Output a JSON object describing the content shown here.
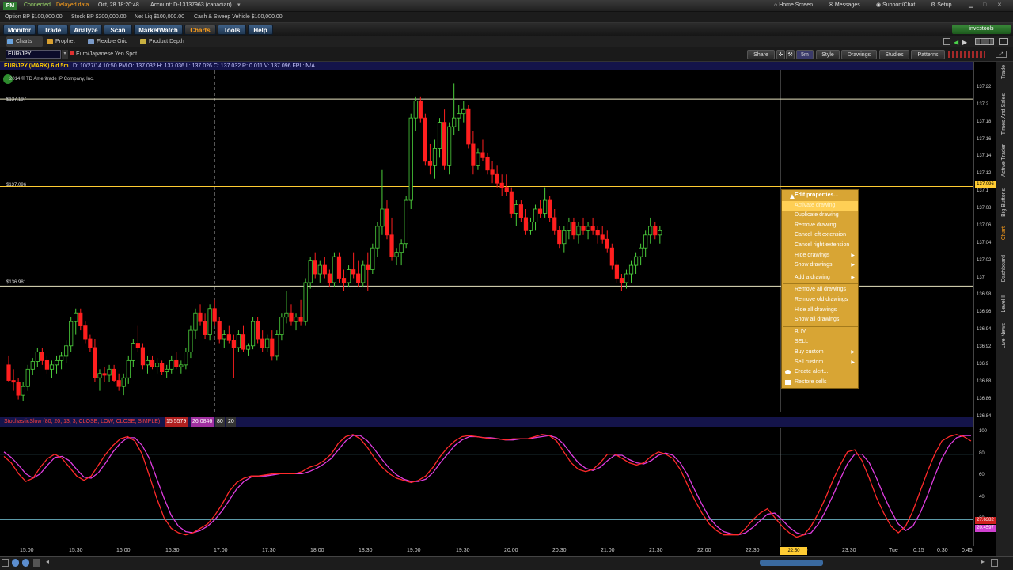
{
  "status_bar": {
    "pm": "PM",
    "connected": "Connected",
    "delayed": "Delayed data",
    "datetime": "Oct, 28 18:20:48",
    "account": "Account: D-13137963 (canadian)",
    "home": "Home Screen",
    "messages": "Messages",
    "support": "Support/Chat",
    "setup": "Setup"
  },
  "balances": {
    "option_bp": "Option BP  $100,000.00",
    "stock_bp": "Stock BP  $200,000.00",
    "net_liq": "Net Liq  $100,000.00",
    "cash": "Cash & Sweep Vehicle  $100,000.00"
  },
  "main_tabs": [
    "Monitor",
    "Trade",
    "Analyze",
    "Scan",
    "MarketWatch",
    "Charts",
    "Tools",
    "Help"
  ],
  "active_tab": "Charts",
  "brand": "investools",
  "sub_tabs": [
    "Charts",
    "Prophet",
    "Flexible Grid",
    "Product Depth"
  ],
  "symbol": {
    "input": "EUR/JPY",
    "description": "Euro/Japanese Yen Spot"
  },
  "toolbar": {
    "share": "Share",
    "timeframe": "5m",
    "style": "Style",
    "drawings": "Drawings",
    "studies": "Studies",
    "patterns": "Patterns"
  },
  "quote_bar": {
    "symbol": "EUR/JPY (MARK) 6 d 5m",
    "ohlc": "D: 10/27/14 10:50 PM   O: 137.032   H: 137.036   L: 137.026   C: 137.032   R: 0.011   V: 137.096   FPL: N/A"
  },
  "copyright": "2014 © TD Ameritrade IP Company, Inc.",
  "price_levels": [
    {
      "label": "$137.197",
      "price": 137.197
    },
    {
      "label": "$137.096",
      "price": 137.096
    },
    {
      "label": "$136.981",
      "price": 136.981
    }
  ],
  "price_axis": [
    "137.22",
    "137.2",
    "137.18",
    "137.16",
    "137.14",
    "137.12",
    "137.1",
    "137.08",
    "137.06",
    "137.04",
    "137.02",
    "137",
    "136.98",
    "136.96",
    "136.94",
    "136.92",
    "136.9",
    "136.88",
    "136.86",
    "136.84"
  ],
  "price_highlight": "137.096",
  "study": {
    "label": "StochasticSlow (80, 20, 13, 3, CLOSE, LOW, CLOSE, SIMPLE)",
    "k": "15.5579",
    "d": "26.0846",
    "ob": "80",
    "os": "20",
    "axis": [
      "100",
      "80",
      "60",
      "40",
      "20"
    ],
    "k_tag": "27.6382",
    "d_tag": "20.4597",
    "colors": {
      "k": "#ff2a2a",
      "d": "#e03ce0"
    }
  },
  "time_axis": [
    "15:00",
    "15:30",
    "16:00",
    "16:30",
    "17:00",
    "17:30",
    "18:00",
    "18:30",
    "19:00",
    "19:30",
    "20:00",
    "20:30",
    "21:00",
    "21:30",
    "22:00",
    "22:30",
    "23:00",
    "23:30",
    "Tue",
    "0:15",
    "0:30",
    "0:45"
  ],
  "time_highlight": "22:50",
  "context_menu": [
    {
      "label": "Edit properties...",
      "bold": true
    },
    {
      "label": "Activate drawing",
      "highlight": true
    },
    {
      "label": "Duplicate drawing"
    },
    {
      "label": "Remove drawing"
    },
    {
      "label": "Cancel left extension"
    },
    {
      "label": "Cancel right extension"
    },
    {
      "label": "Hide drawings",
      "sub": true
    },
    {
      "label": "Show drawings",
      "sub": true
    },
    {
      "sep": true
    },
    {
      "label": "Add a drawing",
      "sub": true
    },
    {
      "sep": true
    },
    {
      "label": "Remove all drawings"
    },
    {
      "label": "Remove old drawings"
    },
    {
      "label": "Hide all drawings"
    },
    {
      "label": "Show all drawings"
    },
    {
      "sep": true
    },
    {
      "label": "BUY"
    },
    {
      "label": "SELL"
    },
    {
      "label": "Buy custom",
      "sub": true
    },
    {
      "label": "Sell custom",
      "sub": true
    },
    {
      "label": "Create alert...",
      "icon": "bell-icon"
    },
    {
      "label": "Restore cells",
      "icon": "cells-icon"
    }
  ],
  "right_sidebar": [
    "Trade",
    "Times And Sales",
    "Active Trader",
    "Big Buttons",
    "Chart",
    "Dashboard",
    "Level II",
    "Live News"
  ],
  "candles": [
    [
      136.89,
      136.9,
      136.87,
      136.872
    ],
    [
      136.872,
      136.885,
      136.86,
      136.87
    ],
    [
      136.87,
      136.875,
      136.85,
      136.855
    ],
    [
      136.855,
      136.87,
      136.848,
      136.865
    ],
    [
      136.865,
      136.89,
      136.86,
      136.885
    ],
    [
      136.885,
      136.898,
      136.878,
      136.894
    ],
    [
      136.894,
      136.91,
      136.888,
      136.905
    ],
    [
      136.905,
      136.91,
      136.89,
      136.895
    ],
    [
      136.895,
      136.9,
      136.88,
      136.885
    ],
    [
      136.885,
      136.895,
      136.875,
      136.89
    ],
    [
      136.89,
      136.9,
      136.88,
      136.895
    ],
    [
      136.895,
      136.905,
      136.885,
      136.9
    ],
    [
      136.9,
      136.918,
      136.892,
      136.912
    ],
    [
      136.912,
      136.945,
      136.905,
      136.94
    ],
    [
      136.94,
      136.955,
      136.925,
      136.95
    ],
    [
      136.95,
      136.955,
      136.93,
      136.935
    ],
    [
      136.935,
      136.94,
      136.915,
      136.92
    ],
    [
      136.92,
      136.925,
      136.905,
      136.91
    ],
    [
      136.91,
      136.92,
      136.87,
      136.875
    ],
    [
      136.875,
      136.885,
      136.86,
      136.88
    ],
    [
      136.88,
      136.888,
      136.87,
      136.878
    ],
    [
      136.878,
      136.89,
      136.87,
      136.885
    ],
    [
      136.885,
      136.89,
      136.87,
      136.872
    ],
    [
      136.872,
      136.88,
      136.86,
      136.865
    ],
    [
      136.865,
      136.88,
      136.855,
      136.875
    ],
    [
      136.875,
      136.9,
      136.868,
      136.895
    ],
    [
      136.895,
      136.92,
      136.888,
      136.915
    ],
    [
      136.915,
      136.935,
      136.905,
      136.91
    ],
    [
      136.91,
      136.915,
      136.885,
      136.89
    ],
    [
      136.89,
      136.9,
      136.88,
      136.895
    ],
    [
      136.895,
      136.9,
      136.885,
      136.888
    ],
    [
      136.888,
      136.898,
      136.88,
      136.892
    ],
    [
      136.892,
      136.895,
      136.878,
      136.882
    ],
    [
      136.882,
      136.89,
      136.875,
      136.885
    ],
    [
      136.885,
      136.9,
      136.88,
      136.895
    ],
    [
      136.895,
      136.905,
      136.885,
      136.888
    ],
    [
      136.888,
      136.895,
      136.88,
      136.89
    ],
    [
      136.89,
      136.91,
      136.885,
      136.905
    ],
    [
      136.905,
      136.935,
      136.898,
      136.93
    ],
    [
      136.93,
      136.955,
      136.92,
      136.95
    ],
    [
      136.95,
      136.96,
      136.935,
      136.94
    ],
    [
      136.94,
      136.95,
      136.92,
      136.925
    ],
    [
      136.925,
      136.96,
      136.918,
      136.955
    ],
    [
      136.955,
      136.965,
      136.935,
      136.94
    ],
    [
      136.94,
      136.945,
      136.915,
      136.92
    ],
    [
      136.92,
      136.93,
      136.91,
      136.925
    ],
    [
      136.925,
      136.935,
      136.915,
      136.918
    ],
    [
      136.918,
      136.925,
      136.875,
      136.91
    ],
    [
      136.91,
      136.93,
      136.905,
      136.925
    ],
    [
      136.925,
      136.935,
      136.905,
      136.908
    ],
    [
      136.908,
      136.915,
      136.9,
      136.912
    ],
    [
      136.912,
      136.945,
      136.908,
      136.94
    ],
    [
      136.94,
      136.945,
      136.915,
      136.92
    ],
    [
      136.92,
      136.93,
      136.905,
      136.91
    ],
    [
      136.91,
      136.925,
      136.905,
      136.92
    ],
    [
      136.92,
      136.93,
      136.895,
      136.9
    ],
    [
      136.9,
      136.93,
      136.895,
      136.925
    ],
    [
      136.925,
      136.95,
      136.918,
      136.945
    ],
    [
      136.945,
      136.975,
      136.938,
      136.95
    ],
    [
      136.95,
      136.96,
      136.935,
      136.94
    ],
    [
      136.94,
      136.95,
      136.93,
      136.945
    ],
    [
      136.945,
      136.965,
      136.935,
      136.94
    ],
    [
      136.94,
      136.99,
      136.935,
      136.985
    ],
    [
      136.985,
      137.015,
      136.978,
      137.01
    ],
    [
      137.01,
      137.02,
      136.99,
      136.995
    ],
    [
      136.995,
      137.01,
      136.985,
      137.005
    ],
    [
      137.005,
      137.015,
      136.99,
      136.995
    ],
    [
      136.995,
      137.0,
      136.98,
      136.985
    ],
    [
      136.985,
      137.02,
      136.98,
      137.015
    ],
    [
      137.015,
      137.02,
      136.985,
      136.99
    ],
    [
      136.99,
      137.0,
      136.975,
      136.985
    ],
    [
      136.985,
      137.005,
      136.98,
      137.0
    ],
    [
      137.0,
      137.02,
      136.99,
      136.995
    ],
    [
      136.995,
      137.01,
      136.98,
      136.985
    ],
    [
      136.985,
      137.01,
      136.98,
      137.005
    ],
    [
      137.005,
      137.02,
      136.975,
      137.0
    ],
    [
      137.0,
      137.03,
      136.995,
      137.025
    ],
    [
      137.025,
      137.055,
      137.015,
      137.05
    ],
    [
      137.05,
      137.115,
      137.04,
      137.07
    ],
    [
      137.07,
      137.08,
      137.035,
      137.04
    ],
    [
      137.04,
      137.06,
      137.01,
      137.015
    ],
    [
      137.015,
      137.025,
      137.005,
      137.02
    ],
    [
      137.02,
      137.035,
      137.005,
      137.03
    ],
    [
      137.03,
      137.085,
      137.025,
      137.08
    ],
    [
      137.08,
      137.18,
      137.07,
      137.175
    ],
    [
      137.175,
      137.2,
      137.16,
      137.195
    ],
    [
      137.195,
      137.2,
      137.17,
      137.175
    ],
    [
      137.175,
      137.18,
      137.12,
      137.125
    ],
    [
      137.125,
      137.145,
      137.11,
      137.12
    ],
    [
      137.12,
      137.15,
      137.105,
      137.14
    ],
    [
      137.14,
      137.175,
      137.13,
      137.17
    ],
    [
      137.17,
      137.185,
      137.115,
      137.12
    ],
    [
      137.12,
      137.17,
      137.11,
      137.165
    ],
    [
      137.165,
      137.215,
      137.155,
      137.175
    ],
    [
      137.175,
      137.19,
      137.16,
      137.18
    ],
    [
      137.18,
      137.195,
      137.17,
      137.185
    ],
    [
      137.185,
      137.19,
      137.14,
      137.145
    ],
    [
      137.145,
      137.16,
      137.11,
      137.12
    ],
    [
      137.12,
      137.14,
      137.115,
      137.135
    ],
    [
      137.135,
      137.15,
      137.125,
      137.13
    ],
    [
      137.13,
      137.135,
      137.11,
      137.115
    ],
    [
      137.115,
      137.125,
      137.1,
      137.11
    ],
    [
      137.11,
      137.12,
      137.095,
      137.1
    ],
    [
      137.1,
      137.11,
      137.085,
      137.095
    ],
    [
      137.095,
      137.11,
      137.085,
      137.09
    ],
    [
      137.09,
      137.095,
      137.06,
      137.065
    ],
    [
      137.065,
      137.08,
      137.05,
      137.075
    ],
    [
      137.075,
      137.08,
      137.055,
      137.06
    ],
    [
      137.06,
      137.07,
      137.04,
      137.045
    ],
    [
      137.045,
      137.06,
      137.04,
      137.055
    ],
    [
      137.055,
      137.075,
      137.045,
      137.07
    ],
    [
      137.07,
      137.08,
      137.06,
      137.065
    ],
    [
      137.065,
      137.095,
      137.06,
      137.08
    ],
    [
      137.08,
      137.085,
      137.055,
      137.06
    ],
    [
      137.06,
      137.07,
      137.04,
      137.045
    ],
    [
      137.045,
      137.05,
      137.025,
      137.03
    ],
    [
      137.03,
      137.05,
      137.02,
      137.045
    ],
    [
      137.045,
      137.06,
      137.035,
      137.055
    ],
    [
      137.055,
      137.06,
      137.035,
      137.04
    ],
    [
      137.04,
      137.055,
      137.03,
      137.05
    ],
    [
      137.05,
      137.06,
      137.04,
      137.045
    ],
    [
      137.045,
      137.055,
      137.035,
      137.05
    ],
    [
      137.05,
      137.06,
      137.04,
      137.045
    ],
    [
      137.045,
      137.05,
      137.03,
      137.04
    ],
    [
      137.04,
      137.05,
      137.03,
      137.035
    ],
    [
      137.035,
      137.045,
      137.02,
      137.025
    ],
    [
      137.025,
      137.03,
      137.0,
      137.005
    ],
    [
      137.005,
      137.01,
      136.985,
      136.99
    ],
    [
      136.99,
      136.995,
      136.975,
      136.985
    ],
    [
      136.985,
      137.0,
      136.978,
      136.995
    ],
    [
      136.995,
      137.01,
      136.985,
      137.005
    ],
    [
      137.005,
      137.02,
      136.995,
      137.015
    ],
    [
      137.015,
      137.03,
      137.005,
      137.025
    ],
    [
      137.025,
      137.045,
      137.015,
      137.04
    ],
    [
      137.04,
      137.06,
      137.03,
      137.05
    ],
    [
      137.05,
      137.055,
      137.035,
      137.04
    ],
    [
      137.04,
      137.05,
      137.03,
      137.045
    ]
  ],
  "stoch_k": [
    78,
    72,
    62,
    55,
    58,
    68,
    76,
    80,
    76,
    68,
    60,
    56,
    60,
    70,
    80,
    88,
    94,
    96,
    92,
    80,
    60,
    40,
    22,
    12,
    8,
    6,
    8,
    12,
    16,
    24,
    34,
    46,
    54,
    58,
    60,
    60,
    61,
    62,
    62,
    62,
    62,
    64,
    68,
    70,
    74,
    80,
    90,
    96,
    98,
    94,
    86,
    76,
    68,
    62,
    58,
    56,
    54,
    56,
    60,
    68,
    78,
    86,
    92,
    96,
    97,
    96,
    95,
    94,
    94,
    93,
    94,
    94,
    94,
    96,
    98,
    97,
    92,
    82,
    72,
    66,
    64,
    66,
    72,
    80,
    80,
    76,
    72,
    70,
    72,
    78,
    82,
    80,
    76,
    66,
    52,
    38,
    26,
    16,
    10,
    6,
    6,
    6,
    12,
    20,
    26,
    30,
    22,
    14,
    8,
    4,
    6,
    14,
    26,
    40,
    56,
    70,
    82,
    84,
    74,
    58,
    40,
    26,
    14,
    8,
    14,
    28,
    46,
    64,
    80,
    92,
    96,
    98,
    96,
    92
  ],
  "stoch_d": [
    82,
    77,
    70,
    62,
    58,
    62,
    70,
    77,
    78,
    74,
    66,
    59,
    58,
    63,
    72,
    82,
    90,
    95,
    95,
    88,
    76,
    58,
    40,
    24,
    14,
    9,
    8,
    10,
    14,
    20,
    28,
    38,
    48,
    55,
    59,
    60,
    60,
    61,
    62,
    62,
    62,
    62,
    64,
    67,
    71,
    76,
    84,
    92,
    97,
    97,
    92,
    84,
    75,
    67,
    61,
    57,
    55,
    55,
    57,
    63,
    72,
    80,
    88,
    93,
    96,
    96,
    95,
    95,
    94,
    93,
    93,
    94,
    94,
    95,
    96,
    97,
    95,
    89,
    80,
    72,
    67,
    65,
    68,
    74,
    79,
    79,
    75,
    72,
    71,
    74,
    79,
    81,
    79,
    72,
    61,
    47,
    34,
    22,
    14,
    9,
    7,
    6,
    8,
    13,
    19,
    25,
    26,
    20,
    13,
    8,
    6,
    8,
    16,
    28,
    42,
    57,
    71,
    80,
    80,
    72,
    58,
    42,
    28,
    16,
    10,
    14,
    26,
    42,
    60,
    76,
    88,
    95,
    97,
    97
  ]
}
